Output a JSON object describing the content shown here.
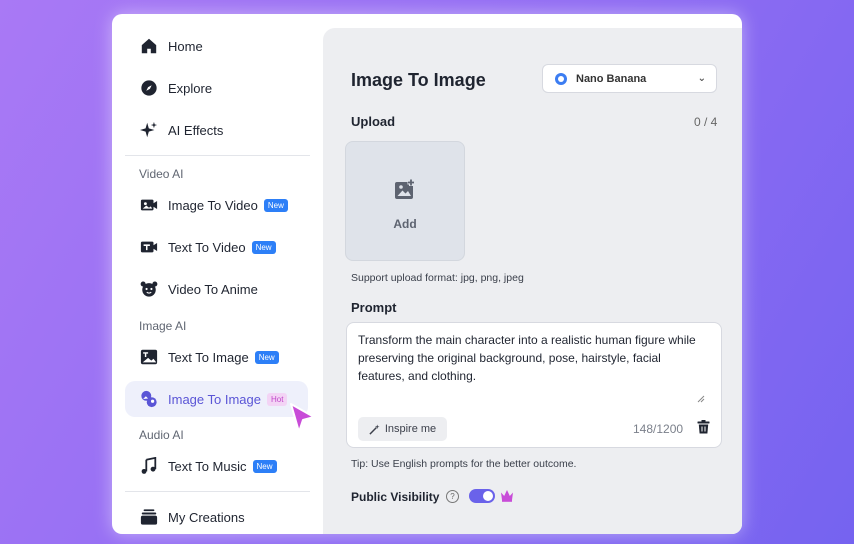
{
  "sidebar": {
    "top": [
      {
        "label": "Home",
        "icon": "home-icon"
      },
      {
        "label": "Explore",
        "icon": "compass-icon"
      },
      {
        "label": "AI Effects",
        "icon": "sparkles-icon"
      }
    ],
    "sections": [
      {
        "title": "Video AI",
        "items": [
          {
            "label": "Image To Video",
            "badge": "New",
            "icon": "image-video-icon"
          },
          {
            "label": "Text To Video",
            "badge": "New",
            "icon": "text-video-icon"
          },
          {
            "label": "Video To Anime",
            "badge": "",
            "icon": "anime-icon"
          }
        ]
      },
      {
        "title": "Image AI",
        "items": [
          {
            "label": "Text To Image",
            "badge": "New",
            "icon": "text-image-icon"
          },
          {
            "label": "Image To Image",
            "badge": "Hot",
            "icon": "image-image-icon",
            "active": true
          }
        ]
      },
      {
        "title": "Audio AI",
        "items": [
          {
            "label": "Text To Music",
            "badge": "New",
            "icon": "music-icon"
          }
        ]
      }
    ],
    "bottom": {
      "label": "My Creations",
      "icon": "creations-icon"
    }
  },
  "main": {
    "title": "Image To Image",
    "model": {
      "selected": "Nano Banana"
    },
    "upload": {
      "label": "Upload",
      "count": "0 / 4",
      "add_label": "Add",
      "support_text": "Support upload format: jpg, png, jpeg"
    },
    "prompt": {
      "label": "Prompt",
      "text": "Transform the main character into a realistic human figure while preserving the original background, pose, hairstyle, facial features, and clothing.",
      "inspire_label": "Inspire me",
      "char_count": "148/1200",
      "tip": "Tip: Use English prompts for the better outcome."
    },
    "visibility": {
      "label": "Public Visibility",
      "help": "?",
      "enabled": true
    }
  },
  "colors": {
    "accent": "#6a62ea",
    "new_badge": "#2d7ff7",
    "hot_badge_bg": "#f3d4f5",
    "hot_badge_text": "#c046c9",
    "active_bg": "#eef0fb",
    "active_text": "#5a55d6"
  }
}
